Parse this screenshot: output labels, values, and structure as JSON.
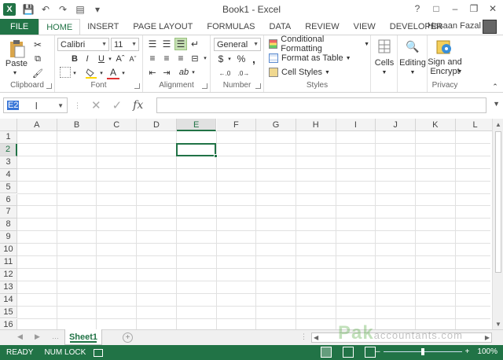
{
  "window": {
    "title": "Book1 - Excel",
    "logo": "X",
    "user": "Hasaan Fazal"
  },
  "tabs": [
    "FILE",
    "HOME",
    "INSERT",
    "PAGE LAYOUT",
    "FORMULAS",
    "DATA",
    "REVIEW",
    "VIEW",
    "DEVELOPER"
  ],
  "active_tab": "HOME",
  "ribbon": {
    "clipboard": {
      "label": "Clipboard",
      "paste": "Paste"
    },
    "font": {
      "label": "Font",
      "name": "Calibri",
      "size": "11",
      "bold": "B",
      "italic": "I",
      "underline": "U"
    },
    "alignment": {
      "label": "Alignment"
    },
    "number": {
      "label": "Number",
      "format": "General",
      "currency": "$",
      "percent": "%",
      "comma": ","
    },
    "styles": {
      "label": "Styles",
      "conditional": "Conditional Formatting",
      "table": "Format as Table",
      "cell_styles": "Cell Styles"
    },
    "cells": {
      "label": "Cells"
    },
    "editing": {
      "label": "Editing"
    },
    "privacy": {
      "label": "Privacy",
      "sign_line1": "Sign and",
      "sign_line2": "Encrypt"
    }
  },
  "formula_bar": {
    "name_box": "E2",
    "fx": "fx",
    "content": ""
  },
  "grid": {
    "columns": [
      "A",
      "B",
      "C",
      "D",
      "E",
      "F",
      "G",
      "H",
      "I",
      "J",
      "K",
      "L"
    ],
    "rows": [
      "1",
      "2",
      "3",
      "4",
      "5",
      "6",
      "7",
      "8",
      "9",
      "10",
      "11",
      "12",
      "13",
      "14",
      "15",
      "16"
    ],
    "active_col": "E",
    "active_row": "2"
  },
  "sheets": [
    "Sheet1"
  ],
  "status": {
    "ready": "READY",
    "numlock": "NUM LOCK",
    "zoom": "100%"
  },
  "watermark": {
    "main": "Pak",
    "sub": "accountants.com"
  },
  "colors": {
    "accent": "#217346"
  }
}
